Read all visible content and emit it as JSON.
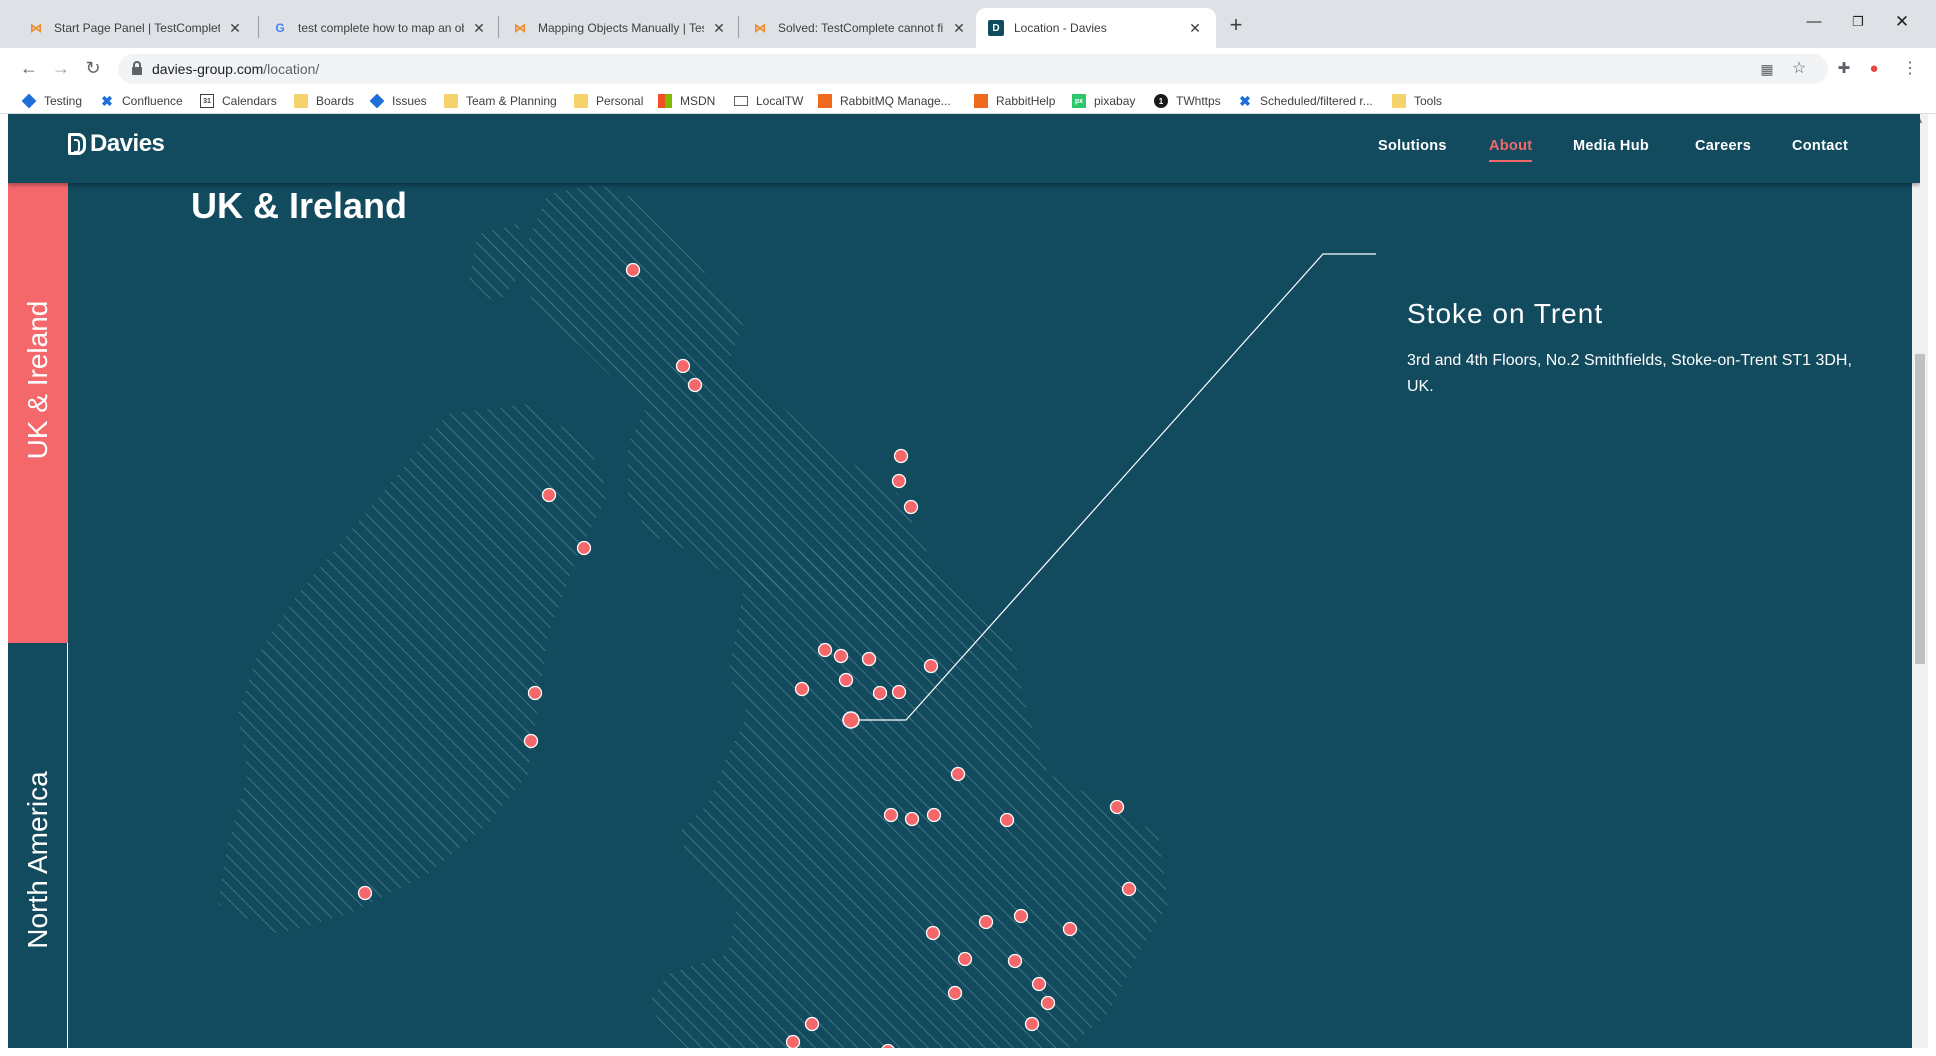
{
  "browser": {
    "tabs": [
      {
        "title": "Start Page Panel | TestComplete D",
        "icon": "testcomplete-icon",
        "active": false
      },
      {
        "title": "test complete how to map an obj",
        "icon": "google-icon",
        "active": false
      },
      {
        "title": "Mapping Objects Manually | Test",
        "icon": "testcomplete-icon",
        "active": false
      },
      {
        "title": "Solved: TestComplete cannot fin",
        "icon": "testcomplete-icon",
        "active": false
      },
      {
        "title": "Location - Davies",
        "icon": "davies-icon",
        "active": true
      }
    ],
    "url_host": "davies-group.com",
    "url_path": "/location/",
    "bookmarks": [
      {
        "label": "Testing",
        "icon": "jira-icon"
      },
      {
        "label": "Confluence",
        "icon": "confluence-icon"
      },
      {
        "label": "Calendars",
        "icon": "calendar-icon"
      },
      {
        "label": "Boards",
        "icon": "folder-icon"
      },
      {
        "label": "Issues",
        "icon": "jira-icon"
      },
      {
        "label": "Team & Planning",
        "icon": "folder-icon"
      },
      {
        "label": "Personal",
        "icon": "folder-icon"
      },
      {
        "label": "MSDN",
        "icon": "microsoft-icon"
      },
      {
        "label": "LocalTW",
        "icon": "computer-icon"
      },
      {
        "label": "RabbitMQ Manage...",
        "icon": "rabbitmq-icon"
      },
      {
        "label": "RabbitHelp",
        "icon": "rabbitmq-icon"
      },
      {
        "label": "pixabay",
        "icon": "pixabay-icon"
      },
      {
        "label": "TWhttps",
        "icon": "onepassword-icon"
      },
      {
        "label": "Scheduled/filtered r...",
        "icon": "confluence-icon"
      },
      {
        "label": "Tools",
        "icon": "folder-icon"
      }
    ]
  },
  "site": {
    "logo_text": "Davies",
    "nav": [
      "Solutions",
      "About",
      "Media Hub",
      "Careers",
      "Contact"
    ],
    "active_nav": "About",
    "side_tabs": [
      "UK & Ireland",
      "North America"
    ],
    "region_title": "UK & Ireland",
    "location": {
      "name": "Stoke on Trent",
      "address": "3rd and 4th Floors, No.2 Smithfields, Stoke-on-Trent ST1 3DH, UK."
    },
    "colors": {
      "background": "#124a5e",
      "accent": "#f4686c",
      "map_hatch": "#4f7e8f",
      "text": "#ffffff"
    }
  }
}
